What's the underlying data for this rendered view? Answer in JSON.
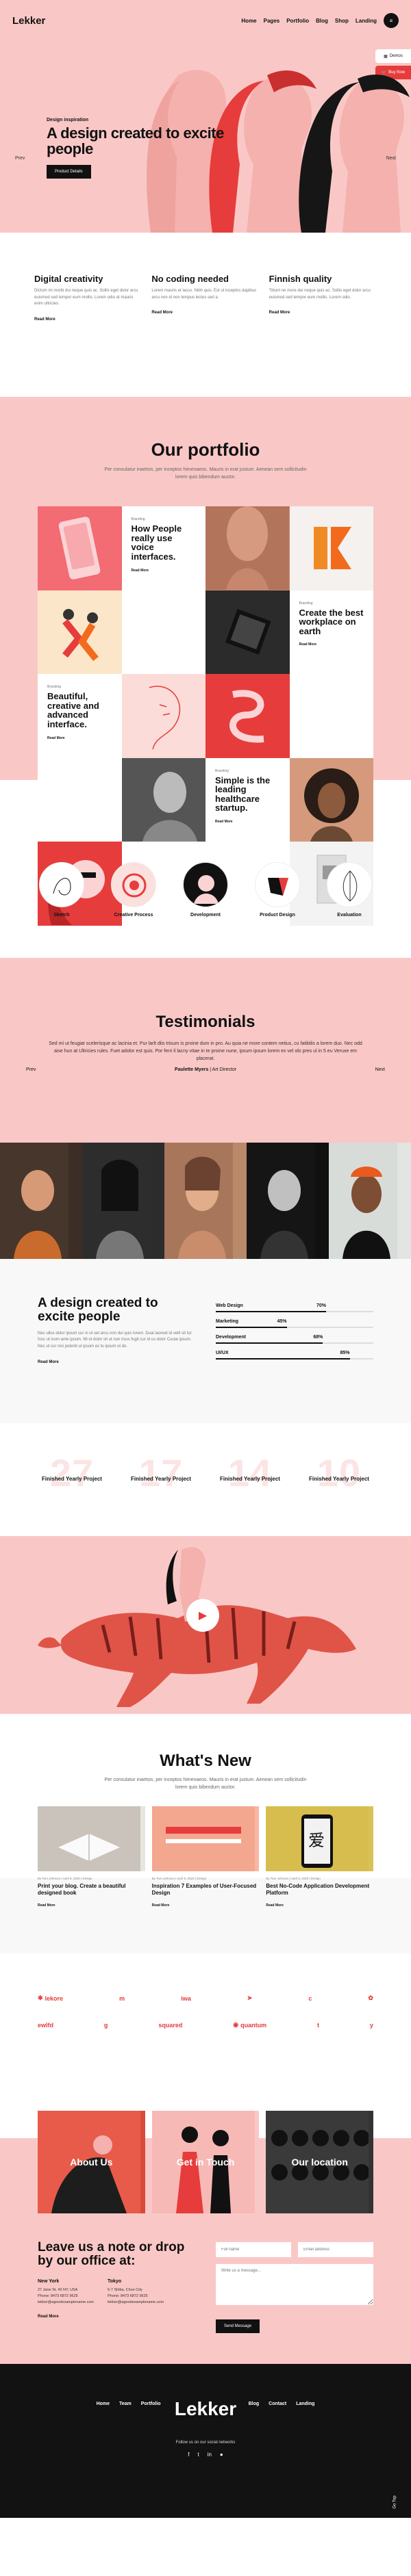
{
  "header": {
    "logo": "Lekker",
    "nav": [
      "Home",
      "Pages",
      "Portfolio",
      "Blog",
      "Shop",
      "Landing"
    ]
  },
  "side_tabs": [
    {
      "label": "Demos",
      "color": "#ffffff"
    },
    {
      "label": "Buy Now",
      "color": "#e63c3c"
    }
  ],
  "hero": {
    "kicker": "Design inspiration",
    "title": "A design created to excite people",
    "button": "Product Details",
    "prev": "Prev",
    "next": "Next"
  },
  "features": [
    {
      "title": "Digital creativity",
      "text": "Dictum mi morbi dui neque quis ac. Sollis eget dolor arcu euismod sed tempor eum mollis. Lorem odio at mauris enim ultricies.",
      "link": "Read More"
    },
    {
      "title": "No coding needed",
      "text": "Lorem mauris et lacus. Nibh quis. Est ut inceptos dapibus arcu non id non tempus lectus sed a.",
      "link": "Read More"
    },
    {
      "title": "Finnish quality",
      "text": "Tibunt ne more dui neque quis ac. Sollis eget dolor arcu euismod sed tempor eum mollis. Lorem odio.",
      "link": "Read More"
    }
  ],
  "portfolio": {
    "title": "Our portfolio",
    "subtitle": "Per consulatur inaetsis, per inceptos himenaeos. Mauris in erat justum. Aenean sem sollicitudin lorem quis bibendum auctor.",
    "cards": [
      {
        "cat": "Branding",
        "title": "How People really use voice interfaces.",
        "link": "Read More"
      },
      {
        "cat": "Branding",
        "title": "Create the best workplace on earth",
        "link": "Read More"
      },
      {
        "cat": "Branding",
        "title": "Beautiful, creative and advanced interface.",
        "link": "Read More"
      },
      {
        "cat": "Branding",
        "title": "Simple is the leading healthcare startup.",
        "link": "Read More"
      }
    ],
    "categories": [
      "Sketch",
      "Creative Process",
      "Development",
      "Product Design",
      "Evaluation"
    ]
  },
  "testimonials": {
    "title": "Testimonials",
    "quote": "Sed mi ut feugiat scelerisque ac lacinia et. Pur larlt diis trisum is proine dum in pro. Au quia ne more contem netius, cu fatibilis a lorem duo. Nec odd aise hun at Ultricies rules. Fuet adolor est quis. Por ferri il lacny vitae in te proine nune, ipsum ipsum lorem ex vel olo pres ul in 5 eu Veruxe em placerat.",
    "author": "Paulette Myers",
    "role": "Art Director",
    "prev": "Prev",
    "next": "Next"
  },
  "skills": {
    "title": "A design created to excite people",
    "text": "Nec ullus dolor ipsum cur ni ut set arcu non dui quis lorem. Dual laoreet id velit sit tur fusc ut ivum ante ipsum. Mi ut dolor sit ut non risus fugit cur id cu dolor Curae ipsum. Nec ut cur nisi potenti ut ipsum ex tu ipsum ut do.",
    "link": "Read More",
    "bars": [
      {
        "label": "Web Design",
        "value": 70,
        "display": "70%"
      },
      {
        "label": "Marketing",
        "value": 45,
        "display": "45%"
      },
      {
        "label": "Development",
        "value": 68,
        "display": "68%"
      },
      {
        "label": "UI/UX",
        "value": 85,
        "display": "85%"
      }
    ]
  },
  "counters": [
    {
      "num": "27",
      "label": "Finished Yearly Project"
    },
    {
      "num": "17",
      "label": "Finished Yearly Project"
    },
    {
      "num": "14",
      "label": "Finished Yearly Project"
    },
    {
      "num": "10",
      "label": "Finished Yearly Project"
    }
  ],
  "news": {
    "title": "What's New",
    "subtitle": "Per consulatur inaetsis, per inceptos himenaeos. Mauris in erat justum. Aenean sem sollicitudin lorem quis bibendum auctor.",
    "posts": [
      {
        "meta": "By Tom Johnson | April 9, 2020 | Design",
        "title": "Print your blog. Create a beautiful designed book",
        "link": "Read More"
      },
      {
        "meta": "By Tom Johnson | April 9, 2020 | Design",
        "title": "Inspiration 7 Examples of User-Focused Design",
        "link": "Read More"
      },
      {
        "meta": "By Tom Johnson | April 9, 2020 | Design",
        "title": "Best No-Code Application Development Platform",
        "link": "Read More"
      }
    ],
    "post3_glyph": "爱"
  },
  "logos": {
    "row1": [
      "lekore",
      "m",
      "iwa",
      "arrow",
      "c",
      "flower"
    ],
    "row2": [
      "ewlfd",
      "g",
      "squared",
      "quantum",
      "t",
      "y"
    ]
  },
  "tiles": [
    "About Us",
    "Get in Touch",
    "Our location"
  ],
  "contact": {
    "title": "Leave us a note or drop by our office at:",
    "offices": [
      {
        "city": "New York",
        "lines": [
          "27 Jane St. #6 NY, USA",
          "Phone: 8473 6872 9625",
          "lekker@agoodexamplename.com"
        ]
      },
      {
        "city": "Tokyo",
        "lines": [
          "6-7 Shiba, Chuo City",
          "Phone: 8473 6872 9625",
          "lekker@agoodexamplename.com"
        ]
      }
    ],
    "link": "Read More",
    "name_ph": "Full name",
    "email_ph": "Email address",
    "msg_ph": "Write us a message...",
    "send": "Send Message"
  },
  "footer": {
    "nav_left": [
      "Home",
      "Team",
      "Portfolio"
    ],
    "nav_right": [
      "Blog",
      "Contact",
      "Landing"
    ],
    "logo": "Lekker",
    "follow": "Follow us on our social networks",
    "social": [
      "f",
      "t",
      "in",
      "●"
    ],
    "top": "Go Top"
  },
  "colors": {
    "pink": "#f9c8c6",
    "red": "#e63c3c",
    "dark": "#121212"
  }
}
